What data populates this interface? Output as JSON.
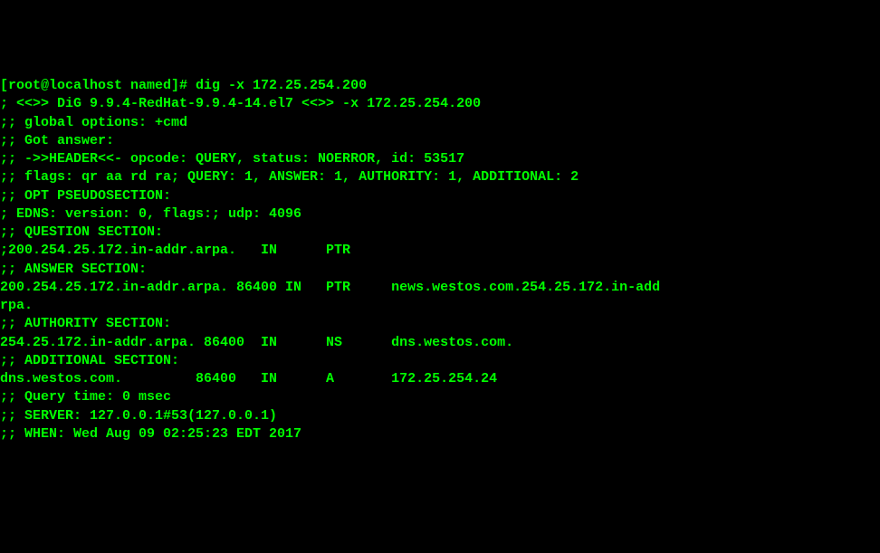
{
  "prompt": {
    "user": "root",
    "host": "localhost",
    "path": "named",
    "command": "dig -x 172.25.254.200"
  },
  "lines": {
    "l0": "[root@localhost named]# dig -x 172.25.254.200",
    "l1": "",
    "l2": "; <<>> DiG 9.9.4-RedHat-9.9.4-14.el7 <<>> -x 172.25.254.200",
    "l3": ";; global options: +cmd",
    "l4": ";; Got answer:",
    "l5": ";; ->>HEADER<<- opcode: QUERY, status: NOERROR, id: 53517",
    "l6": ";; flags: qr aa rd ra; QUERY: 1, ANSWER: 1, AUTHORITY: 1, ADDITIONAL: 2",
    "l7": "",
    "l8": ";; OPT PSEUDOSECTION:",
    "l9": "; EDNS: version: 0, flags:; udp: 4096",
    "l10": ";; QUESTION SECTION:",
    "l11": ";200.254.25.172.in-addr.arpa.   IN      PTR",
    "l12": "",
    "l13": ";; ANSWER SECTION:",
    "l14": "200.254.25.172.in-addr.arpa. 86400 IN   PTR     news.westos.com.254.25.172.in-add",
    "l15": "rpa.",
    "l16": "",
    "l17": ";; AUTHORITY SECTION:",
    "l18": "254.25.172.in-addr.arpa. 86400  IN      NS      dns.westos.com.",
    "l19": "",
    "l20": ";; ADDITIONAL SECTION:",
    "l21": "dns.westos.com.         86400   IN      A       172.25.254.24",
    "l22": "",
    "l23": ";; Query time: 0 msec",
    "l24": ";; SERVER: 127.0.0.1#53(127.0.0.1)",
    "l25": ";; WHEN: Wed Aug 09 02:25:23 EDT 2017"
  },
  "dig": {
    "version": "9.9.4-RedHat-9.9.4-14.el7",
    "query_arg": "-x 172.25.254.200",
    "global_options": "+cmd",
    "header": {
      "opcode": "QUERY",
      "status": "NOERROR",
      "id": 53517
    },
    "flags": [
      "qr",
      "aa",
      "rd",
      "ra"
    ],
    "counts": {
      "QUERY": 1,
      "ANSWER": 1,
      "AUTHORITY": 1,
      "ADDITIONAL": 2
    },
    "edns": {
      "version": 0,
      "flags": "",
      "udp": 4096
    },
    "question": {
      "name": "200.254.25.172.in-addr.arpa.",
      "class": "IN",
      "type": "PTR"
    },
    "answer": [
      {
        "name": "200.254.25.172.in-addr.arpa.",
        "ttl": 86400,
        "class": "IN",
        "type": "PTR",
        "rdata": "news.westos.com.254.25.172.in-addrpa."
      }
    ],
    "authority": [
      {
        "name": "254.25.172.in-addr.arpa.",
        "ttl": 86400,
        "class": "IN",
        "type": "NS",
        "rdata": "dns.westos.com."
      }
    ],
    "additional": [
      {
        "name": "dns.westos.com.",
        "ttl": 86400,
        "class": "IN",
        "type": "A",
        "rdata": "172.25.254.24"
      }
    ],
    "query_time": "0 msec",
    "server": "127.0.0.1#53(127.0.0.1)"
  }
}
